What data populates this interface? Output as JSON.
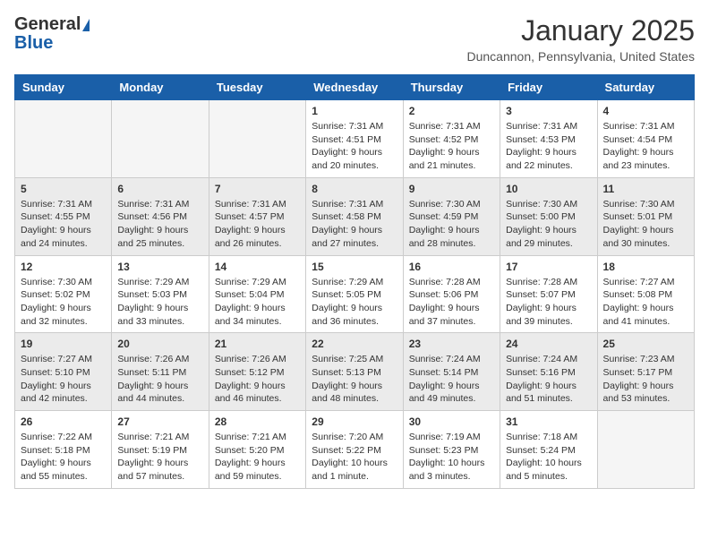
{
  "logo": {
    "line1": "General",
    "line2": "Blue"
  },
  "header": {
    "month": "January 2025",
    "location": "Duncannon, Pennsylvania, United States"
  },
  "weekdays": [
    "Sunday",
    "Monday",
    "Tuesday",
    "Wednesday",
    "Thursday",
    "Friday",
    "Saturday"
  ],
  "weeks": [
    [
      {
        "day": "",
        "empty": true
      },
      {
        "day": "",
        "empty": true
      },
      {
        "day": "",
        "empty": true
      },
      {
        "day": "1",
        "sunrise": "7:31 AM",
        "sunset": "4:51 PM",
        "daylight": "9 hours and 20 minutes."
      },
      {
        "day": "2",
        "sunrise": "7:31 AM",
        "sunset": "4:52 PM",
        "daylight": "9 hours and 21 minutes."
      },
      {
        "day": "3",
        "sunrise": "7:31 AM",
        "sunset": "4:53 PM",
        "daylight": "9 hours and 22 minutes."
      },
      {
        "day": "4",
        "sunrise": "7:31 AM",
        "sunset": "4:54 PM",
        "daylight": "9 hours and 23 minutes."
      }
    ],
    [
      {
        "day": "5",
        "sunrise": "7:31 AM",
        "sunset": "4:55 PM",
        "daylight": "9 hours and 24 minutes."
      },
      {
        "day": "6",
        "sunrise": "7:31 AM",
        "sunset": "4:56 PM",
        "daylight": "9 hours and 25 minutes."
      },
      {
        "day": "7",
        "sunrise": "7:31 AM",
        "sunset": "4:57 PM",
        "daylight": "9 hours and 26 minutes."
      },
      {
        "day": "8",
        "sunrise": "7:31 AM",
        "sunset": "4:58 PM",
        "daylight": "9 hours and 27 minutes."
      },
      {
        "day": "9",
        "sunrise": "7:30 AM",
        "sunset": "4:59 PM",
        "daylight": "9 hours and 28 minutes."
      },
      {
        "day": "10",
        "sunrise": "7:30 AM",
        "sunset": "5:00 PM",
        "daylight": "9 hours and 29 minutes."
      },
      {
        "day": "11",
        "sunrise": "7:30 AM",
        "sunset": "5:01 PM",
        "daylight": "9 hours and 30 minutes."
      }
    ],
    [
      {
        "day": "12",
        "sunrise": "7:30 AM",
        "sunset": "5:02 PM",
        "daylight": "9 hours and 32 minutes."
      },
      {
        "day": "13",
        "sunrise": "7:29 AM",
        "sunset": "5:03 PM",
        "daylight": "9 hours and 33 minutes."
      },
      {
        "day": "14",
        "sunrise": "7:29 AM",
        "sunset": "5:04 PM",
        "daylight": "9 hours and 34 minutes."
      },
      {
        "day": "15",
        "sunrise": "7:29 AM",
        "sunset": "5:05 PM",
        "daylight": "9 hours and 36 minutes."
      },
      {
        "day": "16",
        "sunrise": "7:28 AM",
        "sunset": "5:06 PM",
        "daylight": "9 hours and 37 minutes."
      },
      {
        "day": "17",
        "sunrise": "7:28 AM",
        "sunset": "5:07 PM",
        "daylight": "9 hours and 39 minutes."
      },
      {
        "day": "18",
        "sunrise": "7:27 AM",
        "sunset": "5:08 PM",
        "daylight": "9 hours and 41 minutes."
      }
    ],
    [
      {
        "day": "19",
        "sunrise": "7:27 AM",
        "sunset": "5:10 PM",
        "daylight": "9 hours and 42 minutes."
      },
      {
        "day": "20",
        "sunrise": "7:26 AM",
        "sunset": "5:11 PM",
        "daylight": "9 hours and 44 minutes."
      },
      {
        "day": "21",
        "sunrise": "7:26 AM",
        "sunset": "5:12 PM",
        "daylight": "9 hours and 46 minutes."
      },
      {
        "day": "22",
        "sunrise": "7:25 AM",
        "sunset": "5:13 PM",
        "daylight": "9 hours and 48 minutes."
      },
      {
        "day": "23",
        "sunrise": "7:24 AM",
        "sunset": "5:14 PM",
        "daylight": "9 hours and 49 minutes."
      },
      {
        "day": "24",
        "sunrise": "7:24 AM",
        "sunset": "5:16 PM",
        "daylight": "9 hours and 51 minutes."
      },
      {
        "day": "25",
        "sunrise": "7:23 AM",
        "sunset": "5:17 PM",
        "daylight": "9 hours and 53 minutes."
      }
    ],
    [
      {
        "day": "26",
        "sunrise": "7:22 AM",
        "sunset": "5:18 PM",
        "daylight": "9 hours and 55 minutes."
      },
      {
        "day": "27",
        "sunrise": "7:21 AM",
        "sunset": "5:19 PM",
        "daylight": "9 hours and 57 minutes."
      },
      {
        "day": "28",
        "sunrise": "7:21 AM",
        "sunset": "5:20 PM",
        "daylight": "9 hours and 59 minutes."
      },
      {
        "day": "29",
        "sunrise": "7:20 AM",
        "sunset": "5:22 PM",
        "daylight": "10 hours and 1 minute."
      },
      {
        "day": "30",
        "sunrise": "7:19 AM",
        "sunset": "5:23 PM",
        "daylight": "10 hours and 3 minutes."
      },
      {
        "day": "31",
        "sunrise": "7:18 AM",
        "sunset": "5:24 PM",
        "daylight": "10 hours and 5 minutes."
      },
      {
        "day": "",
        "empty": true
      }
    ]
  ]
}
